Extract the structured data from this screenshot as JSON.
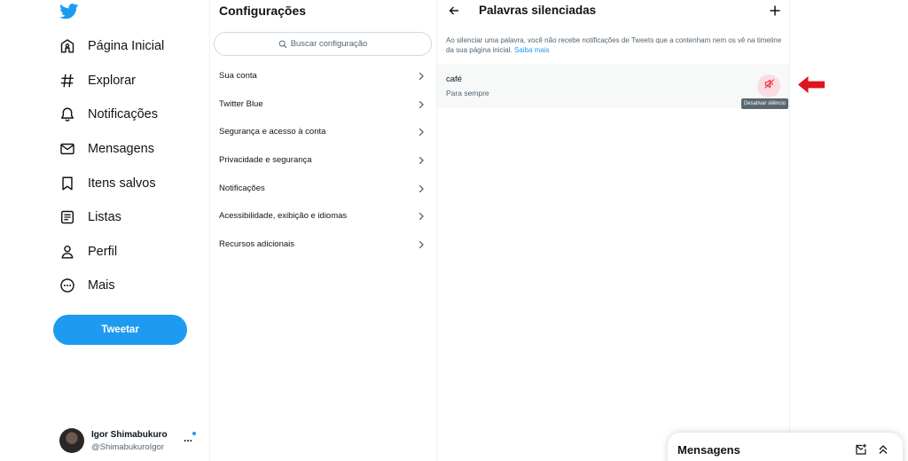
{
  "nav": {
    "items": [
      {
        "label": "Página Inicial",
        "icon": "home-icon"
      },
      {
        "label": "Explorar",
        "icon": "hashtag-icon"
      },
      {
        "label": "Notificações",
        "icon": "bell-icon"
      },
      {
        "label": "Mensagens",
        "icon": "envelope-icon"
      },
      {
        "label": "Itens salvos",
        "icon": "bookmark-icon"
      },
      {
        "label": "Listas",
        "icon": "list-icon"
      },
      {
        "label": "Perfil",
        "icon": "person-icon"
      },
      {
        "label": "Mais",
        "icon": "more-circle-icon"
      }
    ],
    "tweet_label": "Tweetar",
    "account": {
      "name": "Igor Shimabukuro",
      "handle": "@ShimabukuroIgor",
      "more": "..."
    }
  },
  "settings": {
    "title": "Configurações",
    "search_placeholder": "Buscar configuração",
    "items": [
      "Sua conta",
      "Twitter Blue",
      "Segurança e acesso à conta",
      "Privacidade e segurança",
      "Notificações",
      "Acessibilidade, exibição e idiomas",
      "Recursos adicionais"
    ]
  },
  "muted": {
    "title": "Palavras silenciadas",
    "description": "Ao silenciar uma palavra, você não recebe notificações de Tweets que a contenham nem os vê na timeline da sua página inicial.",
    "learn_more": "Saiba mais",
    "word": "café",
    "duration": "Para sempre",
    "tooltip": "Desativar silêncio"
  },
  "drawer": {
    "title": "Mensagens"
  },
  "colors": {
    "accent": "#1d9bf0",
    "unmute_bg": "#fadde3",
    "unmute_icon": "#f4212e",
    "annotation_arrow": "#e0141e"
  }
}
